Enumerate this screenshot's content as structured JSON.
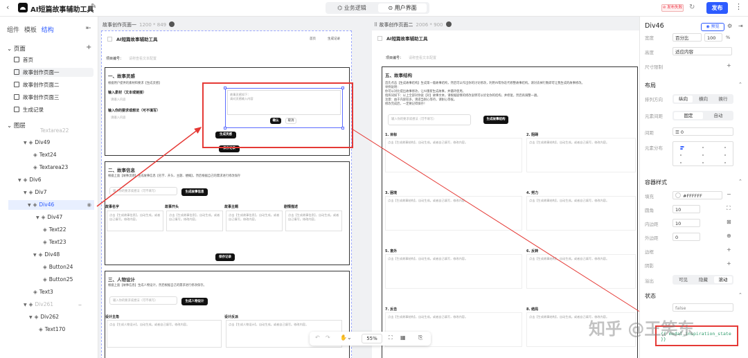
{
  "topbar": {
    "back": "‹",
    "app_title": "AI短篇故事辅助工具",
    "mode_tabs": [
      "业务逻辑",
      "用户界面"
    ],
    "active_mode": "用户界面",
    "save_status": "⊘ 发布失败",
    "publish_label": "发布",
    "more": "⋮"
  },
  "left": {
    "tabs": [
      "组件",
      "模板",
      "结构"
    ],
    "active_tab": "结构",
    "pages_title": "页面",
    "pages": [
      "首页",
      "故事创作页面一",
      "故事创作页面二",
      "故事创作页面三",
      "生成记录"
    ],
    "layers_title": "图层",
    "layers": [
      "Textarea22",
      "Div49",
      "Text24",
      "Textarea23",
      "Div6",
      "Div7",
      "Div46",
      "Div47",
      "Text22",
      "Text23",
      "Div48",
      "Button24",
      "Button25",
      "Text3",
      "Div261",
      "Div262",
      "Text170"
    ]
  },
  "canvas": {
    "frame1": {
      "name": "故事创作页面一",
      "size": "1200 * 849"
    },
    "frame2": {
      "name": "故事创作页面二",
      "size": "2006 * 900"
    },
    "app_name": "AI短篇故事辅助工具",
    "nav": [
      "首页",
      "生成记录"
    ],
    "project_label": "项目编号：",
    "project_ph": "请称查看文本配置",
    "s1": {
      "title": "一、故事灵感",
      "desc": "根据用户提供的素材和要求【生成灵感】",
      "f1_label": "输入素材（文本或链接）",
      "f1_ph": "请输入内容",
      "f2_label": "输入你的要求或想法（可不填写）",
      "f2_ph": "请输入内容",
      "popup_text": "故事灵感如下：",
      "popup_ph": "请对灵感输入内容",
      "confirm": "确认",
      "cancel": "取消",
      "gen_btn": "生成灵感",
      "save_btn": "保存记录"
    },
    "s2": {
      "title": "二、故事信息",
      "desc": "根据上面【故事灵感】生成故事信息【名字、开头、主题、梗概】，然后根据自己的需求进行修改保存",
      "input_ph": "输入你的要求或想法（可不填写）",
      "gen_btn": "生成故事信息",
      "cols": [
        "故事名字",
        "故事开头",
        "故事主题",
        "剧情描述"
      ],
      "cell_ph": "点击【生成故事信息】，自动生成。或者自己填写。修改内容。",
      "save_btn": "保存记录"
    },
    "s3": {
      "title": "三、人物设计",
      "desc": "根据上面【故事信息】生成人物设计，然后根据自己的需求进行修改保存。",
      "input_ph": "输入你的要求或想法（可不填写）",
      "gen_btn": "生成人物设计",
      "cols": [
        "设计主角",
        "设计反派"
      ],
      "cell_ph": "点击【生成人物设计】，自动生成。或者自己填写。修改内容。"
    },
    "s5": {
      "title": "五、故事结构",
      "desc_lines": [
        "首先点击【生成故事结构】生成第一版故事结构，然后可以作出你的讨论修改，利用AI帮你迭代修整故事结构。请对去掉行数即可让我生成的故事修改。",
        "举例说明：",
        "你可以对比提出故事修改，让AI重新生成故事，并循环使用。",
        "指挥词如下：以上全部对你说【对】故事文本，请根据剧情的修改说明可以优化你的结构，并修复，然后再调整一遍。",
        "注意：由于内容较多，请适当耐心等待，请耐心等候。",
        "修改完成后，一定要记得保存！"
      ],
      "input_ph": "输入你的要求或想法（可不填写）",
      "gen_btn": "生成故事结构",
      "cells": [
        "1. 目标",
        "2. 阻碍",
        "3. 困境",
        "4. 努力",
        "5. 意外",
        "6. 反转",
        "7. 反击",
        "8. 结局"
      ],
      "cell_ph": "点击【生成故事结构】，自动生成。或者自己填写，修改内容。"
    },
    "zoom": "55%",
    "toolbar_icons": [
      "undo-icon",
      "redo-icon",
      "hand-icon",
      "fit-icon",
      "grid-icon",
      "export-icon"
    ]
  },
  "right": {
    "title": "Div46",
    "preview": "◉ 预览",
    "width_label": "宽度",
    "width_unit": "百分比",
    "width_value": "100",
    "width_suffix": "%",
    "height_label": "高度",
    "height_value": "适应内容",
    "size_limit": "尺寸限制",
    "layout_title": "布局",
    "dir_label": "排列方向",
    "dir_opts": [
      "纵向",
      "横向",
      "换行"
    ],
    "gap_label": "元素间距",
    "gap_opts": [
      "固定",
      "自动"
    ],
    "spacing_label": "间距",
    "spacing_value": "0",
    "align_label": "元素分布",
    "style_title": "容器样式",
    "fill_label": "填充",
    "fill_value": "#FFFFFF",
    "radius_label": "圆角",
    "radius_value": "10",
    "padding_label": "内边距",
    "padding_value": "10",
    "margin_label": "外边距",
    "margin_value": "0",
    "border_label": "边框",
    "shadow_label": "阴影",
    "overflow_label": "溢出",
    "overflow_opts": [
      "可见",
      "隐藏",
      "滚动"
    ],
    "state_title": "状态",
    "state_value": "false",
    "code_text": "{{ modal_inspiration_state }}"
  },
  "watermark": "知乎 @王笑东"
}
